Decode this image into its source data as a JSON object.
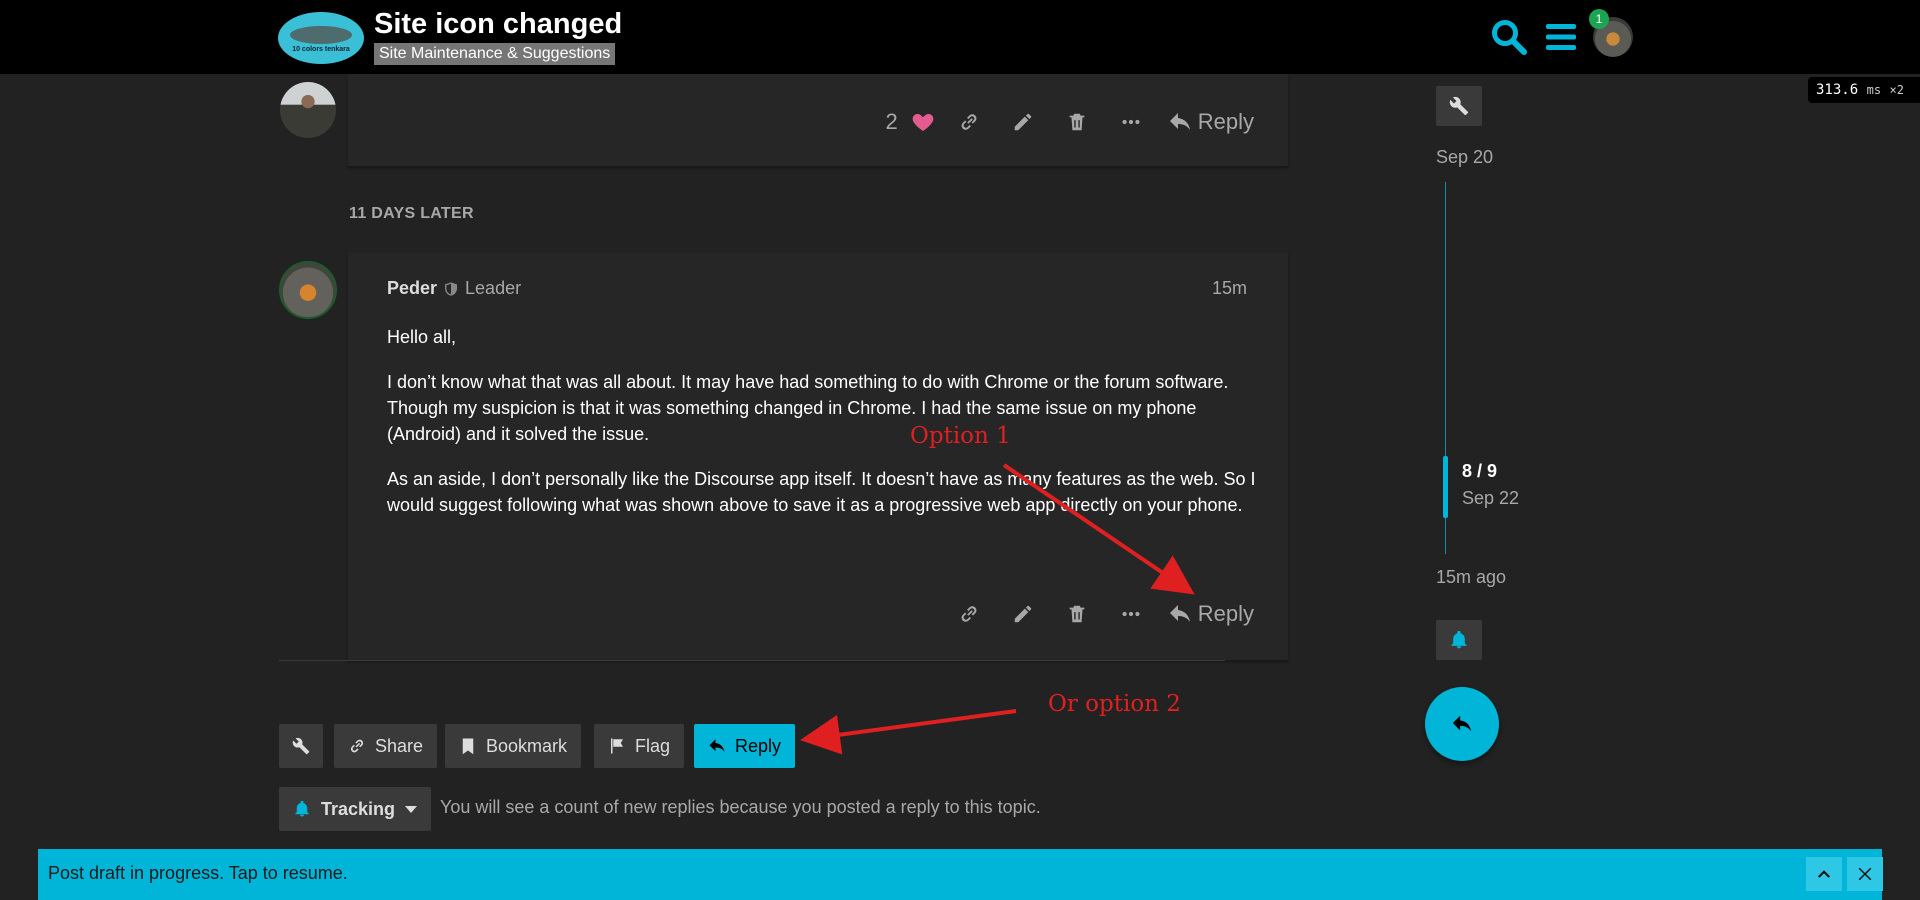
{
  "header": {
    "logo_text": "10 colors tenkara",
    "title": "Site icon changed",
    "category": "Site Maintenance & Suggestions",
    "notification_count": "1",
    "icons": [
      "search-icon",
      "hamburger-menu-icon",
      "user-avatar"
    ]
  },
  "timing": {
    "value": "313.6",
    "unit": "ms",
    "multiplier": "×2"
  },
  "previous_post": {
    "like_count": "2",
    "reply_label": "Reply"
  },
  "gap_label": "11 DAYS LATER",
  "post": {
    "username": "Peder",
    "user_title": "Leader",
    "date": "15m",
    "paragraphs": [
      "Hello all,",
      "I don’t know what that was all about. It may have had something to do with Chrome or the forum software. Though my suspicion is that it was something changed in Chrome. I had the same issue on my phone (Android) and it solved the issue.",
      "As an aside, I don’t personally like the Discourse app itself. It doesn’t have as many features as the web. So I would suggest following what was shown above to save it as a progressive web app directly on your phone."
    ],
    "reply_label": "Reply"
  },
  "footer": {
    "share_label": "Share",
    "bookmark_label": "Bookmark",
    "flag_label": "Flag",
    "reply_label": "Reply",
    "tracking_label": "Tracking",
    "tracking_reason": "You will see a count of new replies because you posted a reply to this topic."
  },
  "timeline": {
    "start_date": "Sep 20",
    "position": "8 / 9",
    "position_date": "Sep 22",
    "last_activity": "15m ago"
  },
  "draft_bar": {
    "text": "Post draft in progress. Tap to resume."
  },
  "annotations": {
    "option1": "Option 1",
    "option2": "Or option 2"
  },
  "colors": {
    "accent": "#00b5d8",
    "like": "#e45c8f",
    "annotation": "#e02020"
  }
}
